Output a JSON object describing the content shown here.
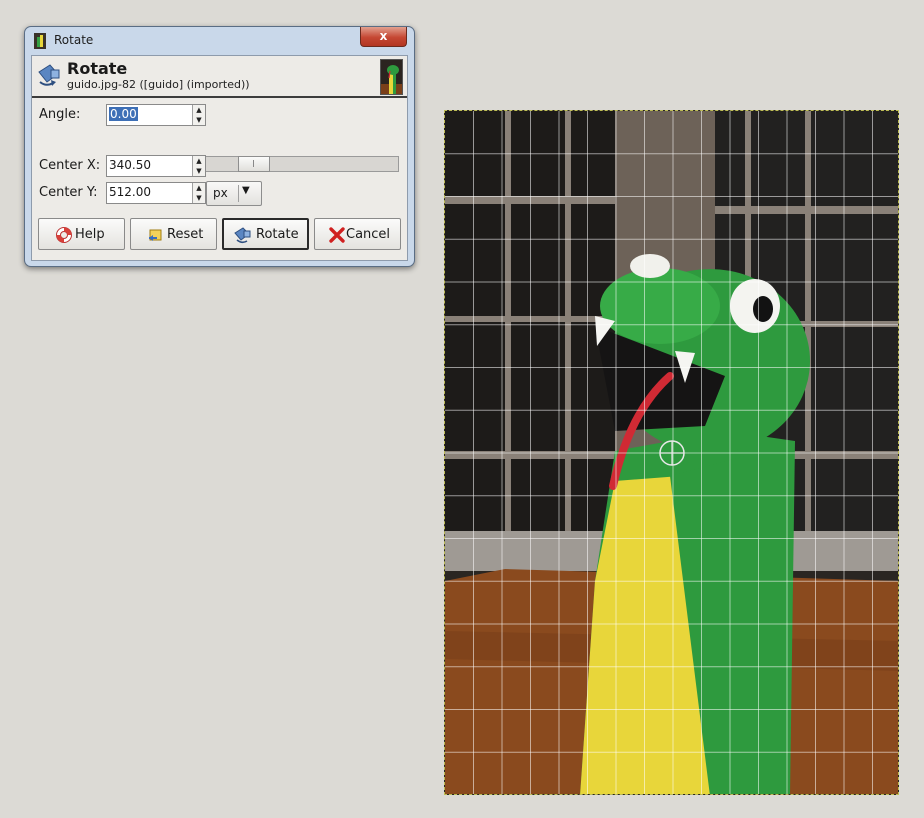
{
  "window": {
    "title": "Rotate",
    "close_glyph": "x"
  },
  "header": {
    "title": "Rotate",
    "subtitle": "guido.jpg-82 ([guido] (imported))",
    "icon": "rotate-tool-icon",
    "thumbnail": "image-thumbnail"
  },
  "angle": {
    "label": "Angle:",
    "value": "0.00",
    "slider_fraction": 0.5
  },
  "center_x": {
    "label": "Center X:",
    "value": "340.50"
  },
  "center_y": {
    "label": "Center Y:",
    "value": "512.00"
  },
  "unit": {
    "value": "px"
  },
  "buttons": {
    "help": "Help",
    "reset": "Reset",
    "rotate": "Rotate",
    "cancel": "Cancel"
  },
  "canvas": {
    "grid": true,
    "pivot": "crosshair"
  },
  "colors": {
    "dialog_frame": "#c9d8ea",
    "selection": "#3d6fb6",
    "snake_green": "#2e9a3e",
    "snake_yellow": "#e8d63a",
    "tongue": "#d02a34",
    "floor": "#8a4a1e"
  }
}
